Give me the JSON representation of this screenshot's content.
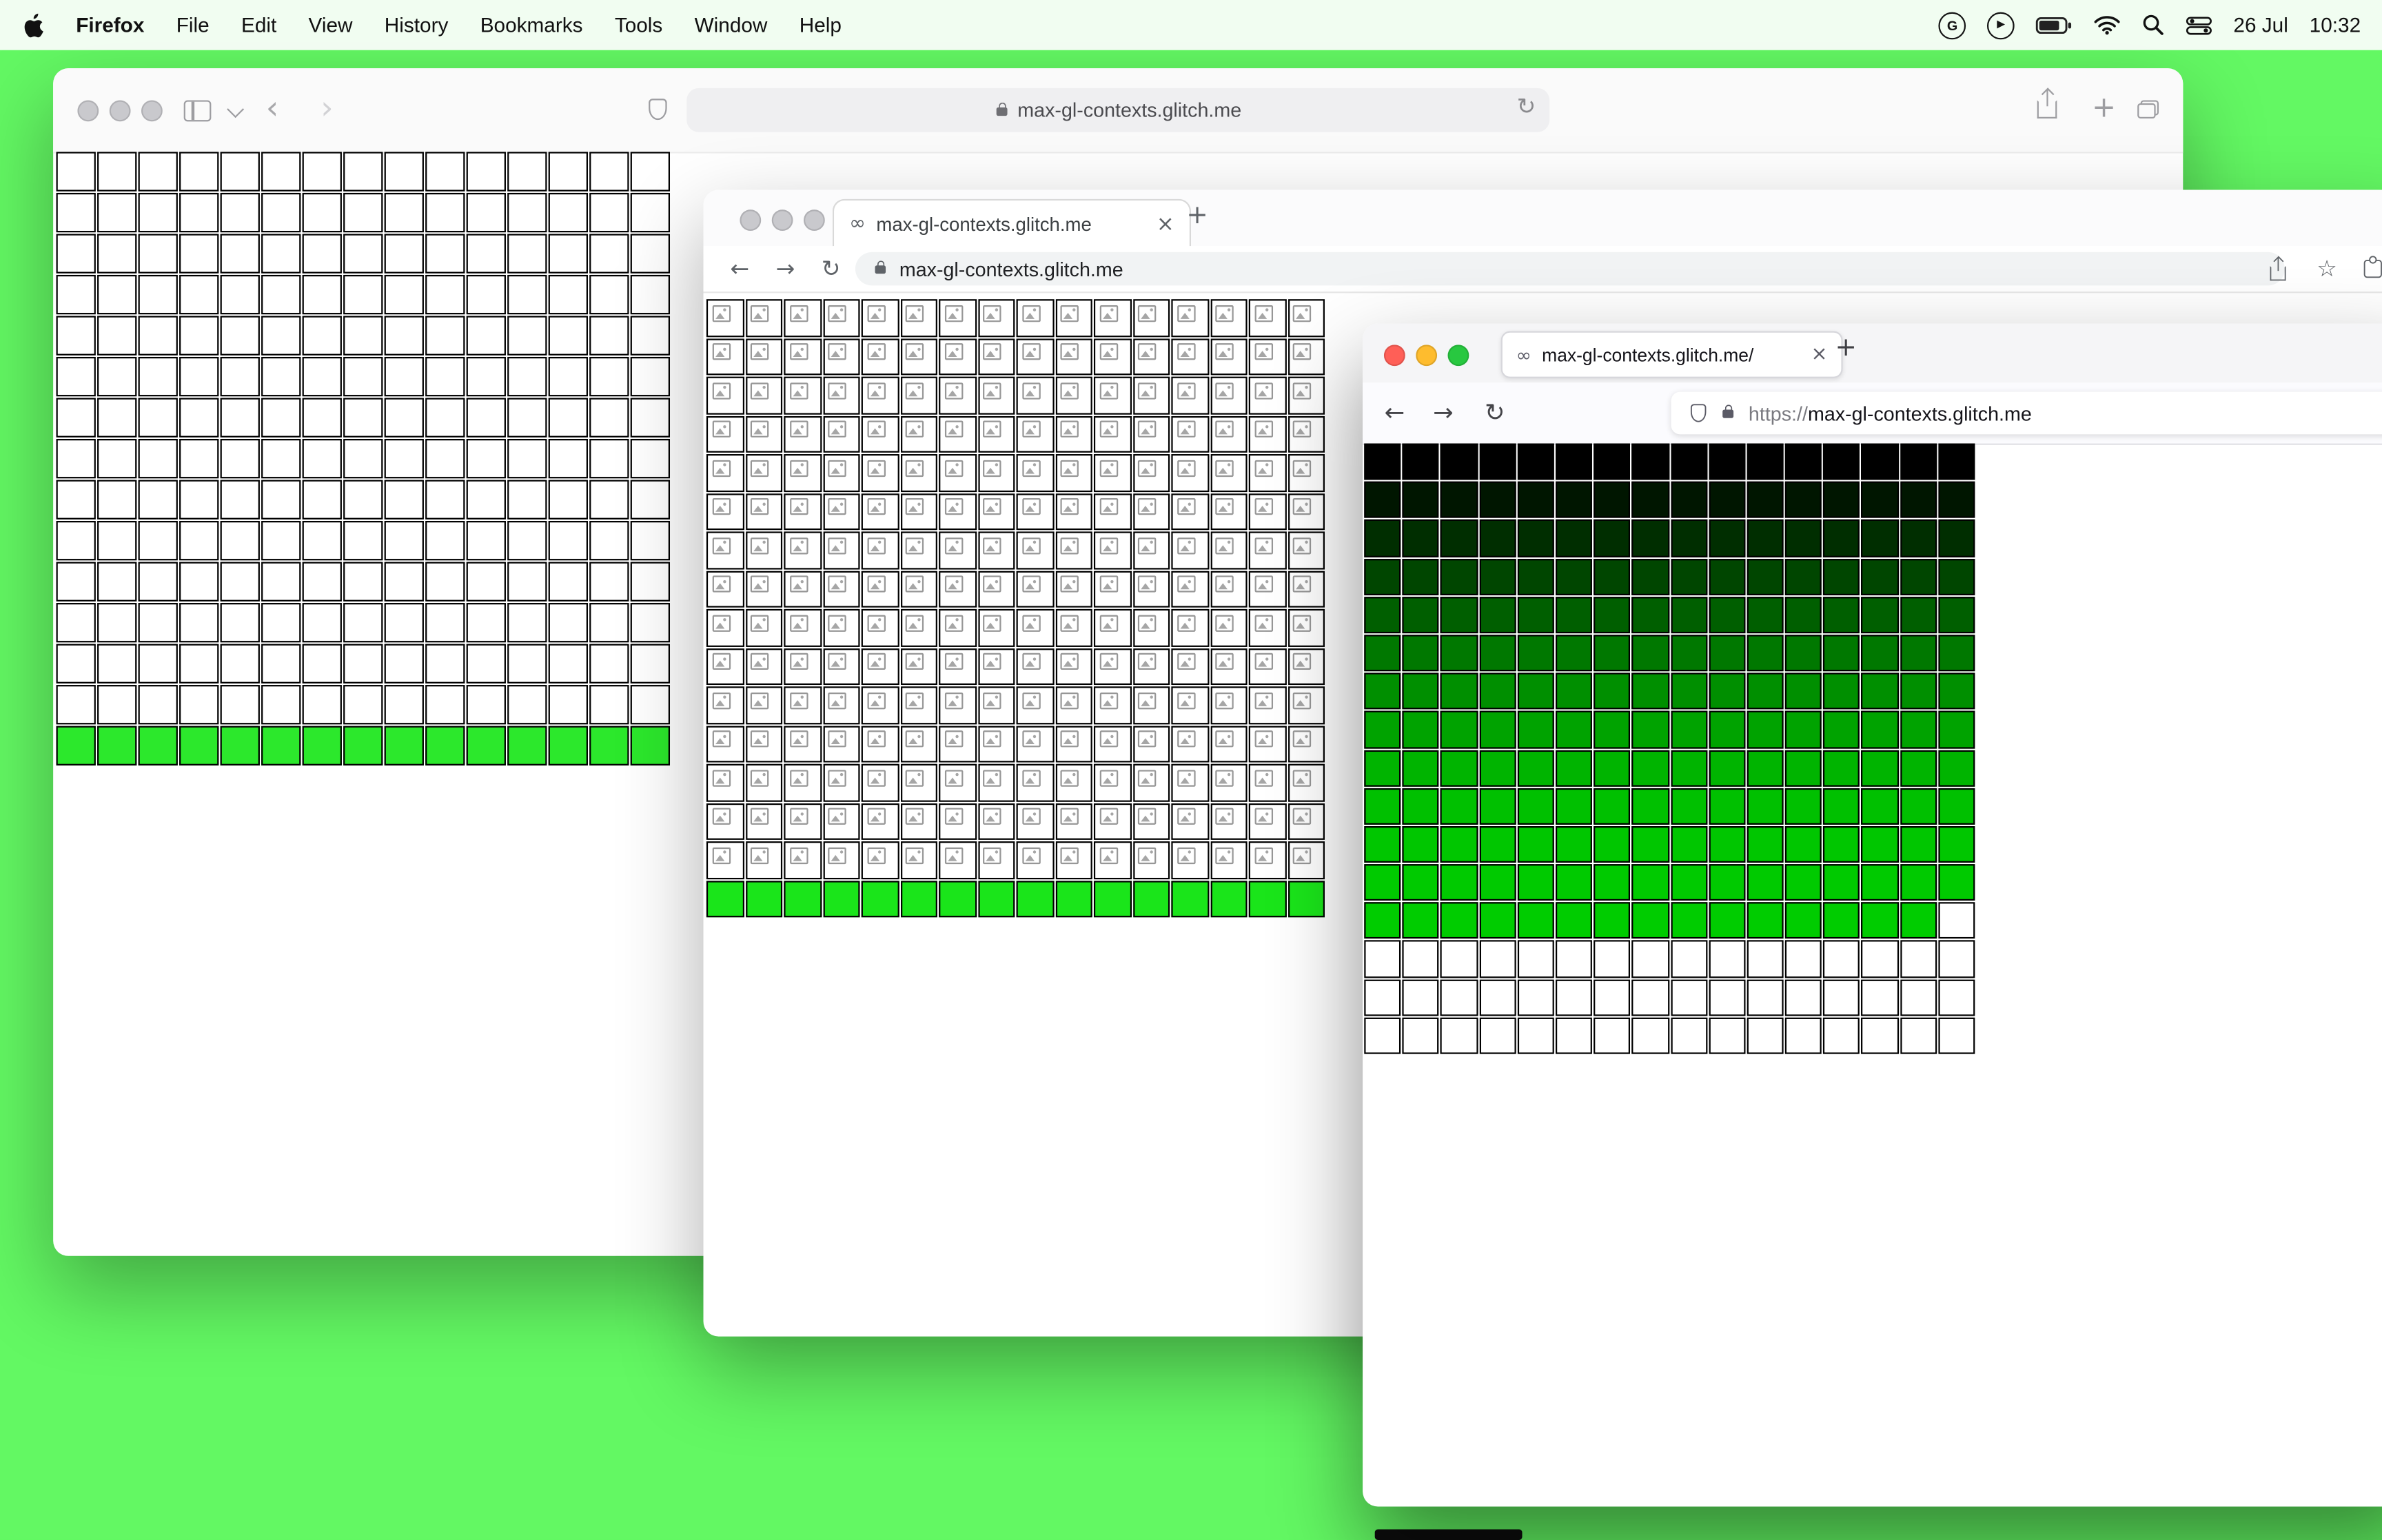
{
  "menubar": {
    "app_name": "Firefox",
    "items": [
      "File",
      "Edit",
      "View",
      "History",
      "Bookmarks",
      "Tools",
      "Window",
      "Help"
    ],
    "status": {
      "date": "26 Jul",
      "time": "10:32"
    }
  },
  "icons": {
    "apple_logo": "apple-logo",
    "g_logo": "G",
    "play": "▶",
    "back_chevron": "‹",
    "forward_chevron": "›",
    "back_arrow": "←",
    "forward_arrow": "→",
    "reload": "↻",
    "plus": "+",
    "close": "×",
    "infinity": "∞",
    "star": "☆"
  },
  "safari_window": {
    "url": "max-gl-contexts.glitch.me"
  },
  "chrome_window": {
    "tab_title": "max-gl-contexts.glitch.me",
    "url": "max-gl-contexts.glitch.me"
  },
  "firefox_window": {
    "tab_title": "max-gl-contexts.glitch.me/",
    "url_scheme": "https://",
    "url_host": "max-gl-contexts.glitch.me"
  },
  "colors": {
    "desktop_background": "#63f863",
    "traffic_inactive": "#c9c9cd",
    "traffic_red": "#ff5f57",
    "traffic_yellow": "#febc2e",
    "traffic_green": "#28c840"
  },
  "grids": {
    "safari": {
      "style": "bottom-green",
      "cols": 15,
      "rows": 15,
      "cell": 26,
      "gap": 1,
      "border": "#000000",
      "fill": "#ffffff",
      "bottom_row_fill": "#2ce82c"
    },
    "chrome": {
      "style": "broken-bottom-green",
      "cols": 16,
      "rows": 16,
      "cell": 24.5,
      "gap": 1,
      "border": "#000000",
      "fill": "#ffffff",
      "bottom_row_fill": "#1ae51a"
    },
    "firefox": {
      "style": "gradient",
      "cols": 16,
      "rows": 16,
      "cell": 24.2,
      "gap": 1,
      "border": "#000000",
      "fill": "#ffffff",
      "row_colors": [
        "#000000",
        "#001600",
        "#002e00",
        "#004600",
        "#005f00",
        "#007800",
        "#008f00",
        "#00a300",
        "#00b400",
        "#00c000",
        "#00c600",
        "#00ca00",
        "#00cc00"
      ],
      "white_cells": [
        [
          12,
          15
        ]
      ]
    }
  }
}
